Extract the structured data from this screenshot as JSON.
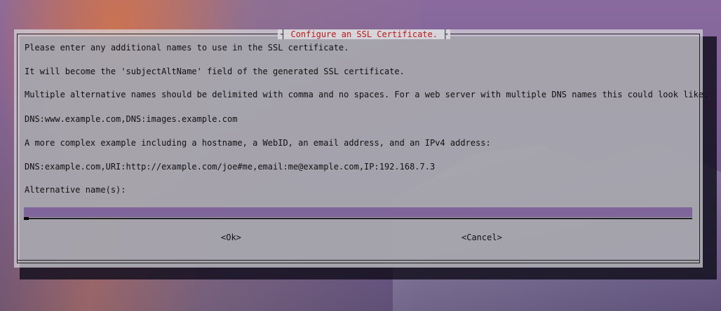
{
  "dialog": {
    "title": "Configure an SSL Certificate.",
    "lines": [
      "Please enter any additional names to use in the SSL certificate.",
      "It will become the 'subjectAltName' field of the generated SSL certificate.",
      "Multiple alternative names should be delimited with comma and no spaces. For a web server with multiple DNS names this could look like:",
      "DNS:www.example.com,DNS:images.example.com",
      "A more complex example including a hostname, a WebID, an email address, and an IPv4 address:",
      "DNS:example.com,URI:http://example.com/joe#me,email:me@example.com,IP:192.168.7.3",
      "Alternative name(s):"
    ],
    "input_value": "",
    "ok_label": "<Ok>",
    "cancel_label": "<Cancel>"
  },
  "colors": {
    "title": "#c01818",
    "input_bg": "#7a5a96"
  }
}
